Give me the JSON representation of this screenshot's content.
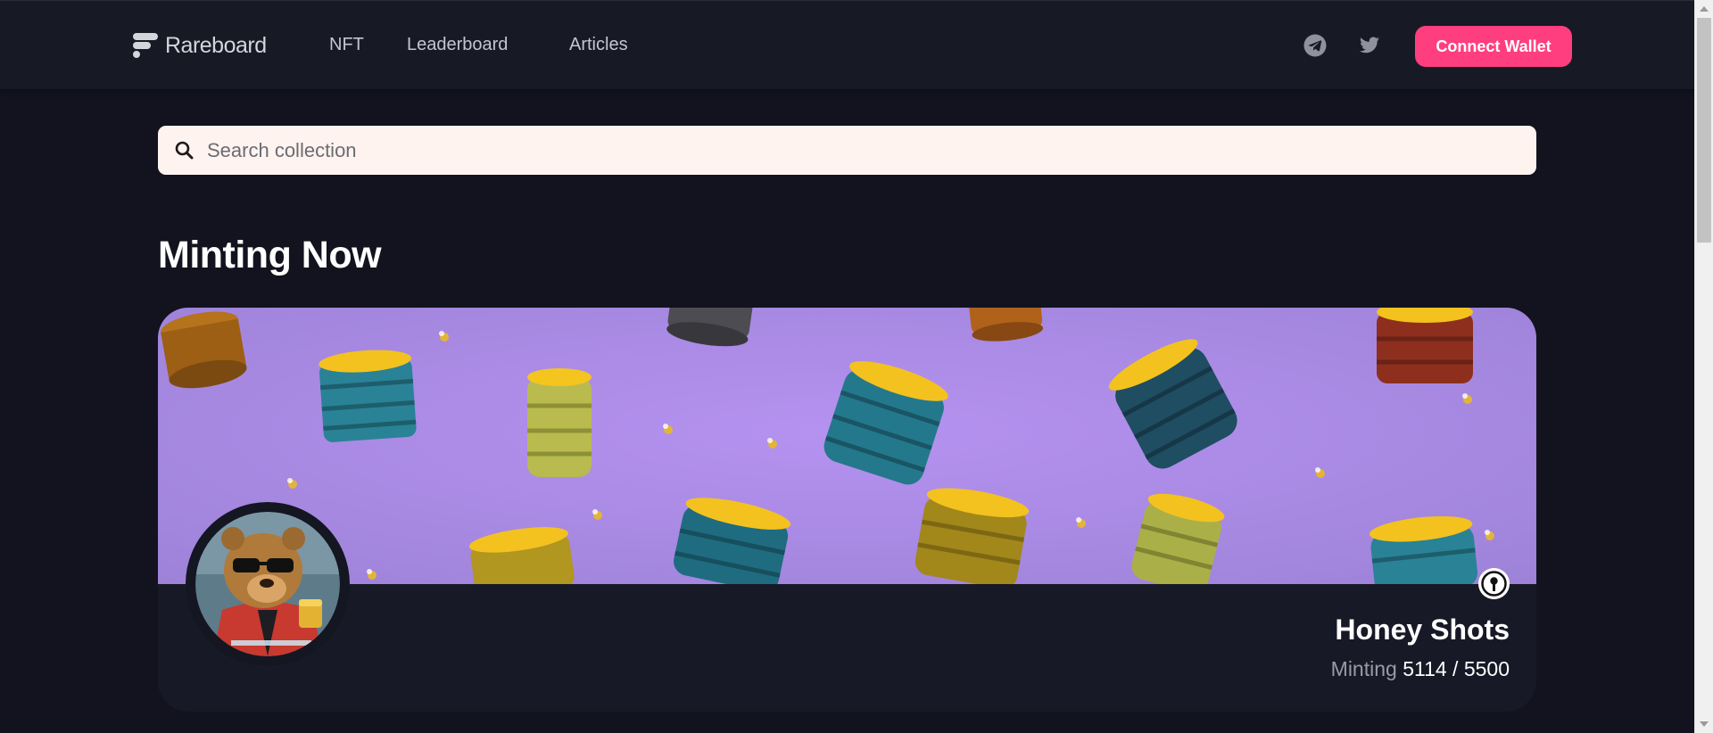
{
  "header": {
    "brand": "Rareboard",
    "nav": [
      {
        "label": "NFT"
      },
      {
        "label": "Leaderboard"
      },
      {
        "label": "Articles"
      }
    ],
    "social": {
      "telegram_icon": "telegram-icon",
      "twitter_icon": "twitter-icon"
    },
    "connect_wallet_label": "Connect Wallet"
  },
  "search": {
    "placeholder": "Search collection",
    "value": ""
  },
  "section": {
    "title": "Minting Now"
  },
  "featured": {
    "name": "Honey Shots",
    "status_label": "Minting",
    "minted_count": "5114 / 5500"
  },
  "colors": {
    "accent": "#ff3e7f",
    "background": "#12131e",
    "header_bg": "#171925",
    "banner_purple": "#a98be3",
    "search_bg": "#fff3f0"
  }
}
